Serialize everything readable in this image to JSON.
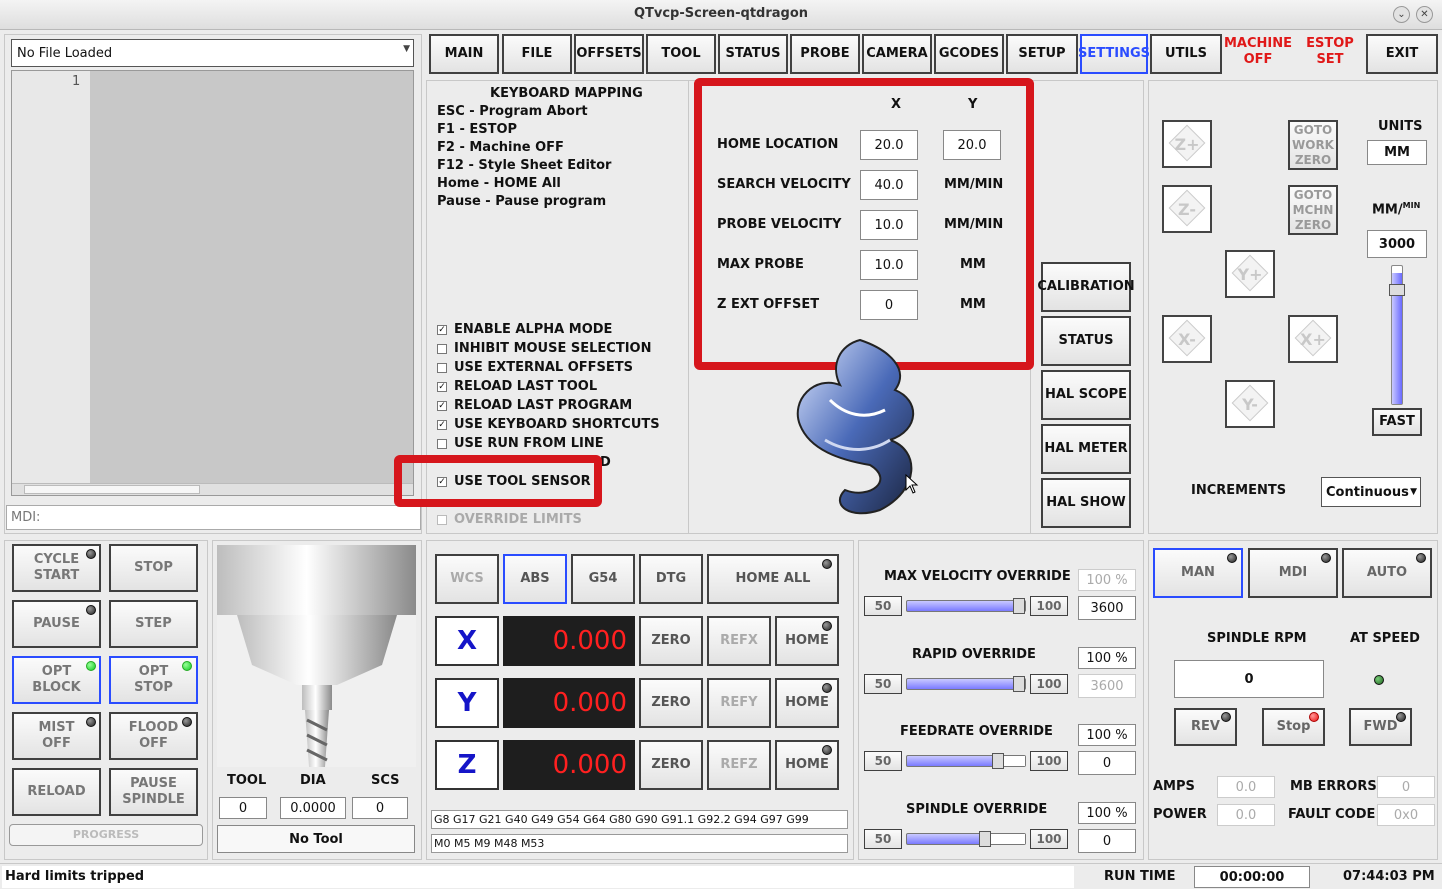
{
  "window": {
    "title": "QTvcp-Screen-qtdragon"
  },
  "file": {
    "selected": "No File Loaded",
    "line_number": "1",
    "mdi_label": "MDI:"
  },
  "tabs": [
    "MAIN",
    "FILE",
    "OFFSETS",
    "TOOL",
    "STATUS",
    "PROBE",
    "CAMERA",
    "GCODES",
    "SETUP",
    "SETTINGS",
    "UTILS"
  ],
  "top_right": {
    "machine": "MACHINE\nOFF",
    "estop": "ESTOP\nSET",
    "exit": "EXIT"
  },
  "keyboard": {
    "title": "KEYBOARD MAPPING",
    "lines": [
      "ESC - Program Abort",
      "F1 - ESTOP",
      "F2 - Machine OFF",
      "F12 - Style Sheet Editor",
      "Home - HOME All",
      "Pause - Pause program"
    ]
  },
  "options": [
    {
      "label": "ENABLE ALPHA MODE",
      "checked": true
    },
    {
      "label": "INHIBIT MOUSE SELECTION",
      "checked": false
    },
    {
      "label": "USE EXTERNAL OFFSETS",
      "checked": false
    },
    {
      "label": "RELOAD LAST TOOL",
      "checked": true
    },
    {
      "label": "RELOAD LAST PROGRAM",
      "checked": true
    },
    {
      "label": "USE KEYBOARD SHORTCUTS",
      "checked": true
    },
    {
      "label": "USE RUN FROM LINE",
      "checked": false
    },
    {
      "label": "D",
      "checked": false
    },
    {
      "label": "USE TOOL SENSOR",
      "checked": true
    },
    {
      "label": "OVERRIDE LIMITS",
      "checked": false
    }
  ],
  "sensor": {
    "col_x": "X",
    "col_y": "Y",
    "home_label": "HOME LOCATION",
    "home_x": "20.0",
    "home_y": "20.0",
    "search_label": "SEARCH VELOCITY",
    "search_val": "40.0",
    "search_unit": "MM/MIN",
    "probe_label": "PROBE VELOCITY",
    "probe_val": "10.0",
    "probe_unit": "MM/MIN",
    "max_label": "MAX PROBE",
    "max_val": "10.0",
    "max_unit": "MM",
    "zext_label": "Z EXT OFFSET",
    "zext_val": "0",
    "zext_unit": "MM"
  },
  "side_buttons": [
    "CALIBRATION",
    "STATUS",
    "HAL SCOPE",
    "HAL METER",
    "HAL SHOW"
  ],
  "jog": {
    "goto_work": "GOTO\nWORK\nZERO",
    "goto_mchn": "GOTO\nMCHN\nZERO",
    "units_label": "UNITS",
    "units_val": "MM",
    "rate_label": "MM/",
    "rate_sup": "MIN",
    "rate_val": "3000",
    "fast": "FAST",
    "increments_label": "INCREMENTS",
    "increments_val": "Continuous",
    "keys": [
      "Z+",
      "Z-",
      "Y+",
      "X-",
      "X+",
      "Y-"
    ],
    "rate_level_pct": 95
  },
  "program": {
    "cycle_start": "CYCLE\nSTART",
    "stop": "STOP",
    "pause": "PAUSE",
    "step": "STEP",
    "opt_block": "OPT\nBLOCK",
    "opt_stop": "OPT\nSTOP",
    "mist": "MIST\nOFF",
    "flood": "FLOOD\nOFF",
    "reload": "RELOAD",
    "pause_spindle": "PAUSE\nSPINDLE",
    "progress": "PROGRESS"
  },
  "tool": {
    "tool_label": "TOOL",
    "dia_label": "DIA",
    "scs_label": "SCS",
    "tool_val": "0",
    "dia_val": "0.0000",
    "scs_val": "0",
    "name": "No Tool"
  },
  "dro": {
    "wcs": "WCS",
    "abs": "ABS",
    "g54": "G54",
    "dtg": "DTG",
    "home_all": "HOME ALL",
    "axes": [
      {
        "name": "X",
        "val": "0.000",
        "ref": "REFX"
      },
      {
        "name": "Y",
        "val": "0.000",
        "ref": "REFY"
      },
      {
        "name": "Z",
        "val": "0.000",
        "ref": "REFZ"
      }
    ],
    "zero": "ZERO",
    "home": "HOME",
    "gcodes": "G8 G17 G21 G40 G49 G54 G64 G80 G90 G91.1 G92.2 G94 G97 G99",
    "mcodes": "M0 M5 M9 M48 M53"
  },
  "overrides": [
    {
      "label": "MAX VELOCITY OVERRIDE",
      "min": "50",
      "max": "100",
      "pct": "100 %",
      "val": "3600",
      "level": 100
    },
    {
      "label": "RAPID OVERRIDE",
      "min": "50",
      "max": "100",
      "pct": "100 %",
      "val": "3600",
      "level": 100
    },
    {
      "label": "FEEDRATE OVERRIDE",
      "min": "50",
      "max": "100",
      "pct": "100 %",
      "val": "0",
      "level": 80
    },
    {
      "label": "SPINDLE OVERRIDE",
      "min": "50",
      "max": "100",
      "pct": "100 %",
      "val": "0",
      "level": 68
    }
  ],
  "mode": {
    "man": "MAN",
    "mdi": "MDI",
    "auto": "AUTO"
  },
  "spindle": {
    "rpm_label": "SPINDLE RPM",
    "at_speed_label": "AT SPEED",
    "rpm": "0",
    "rev": "REV",
    "stop": "Stop",
    "fwd": "FWD",
    "amps_label": "AMPS",
    "amps": "0.0",
    "power_label": "POWER",
    "power": "0.0",
    "mb_label": "MB ERRORS",
    "mb": "0",
    "fault_label": "FAULT CODE",
    "fault": "0x0"
  },
  "statusbar": {
    "message": "Hard limits tripped",
    "runtime_label": "RUN TIME",
    "runtime": "00:00:00",
    "clock": "07:44:03 PM"
  },
  "colors": {
    "red_highlight": "#d6161c",
    "accent_blue": "#2a4cff",
    "dro_red": "#ff2020"
  }
}
